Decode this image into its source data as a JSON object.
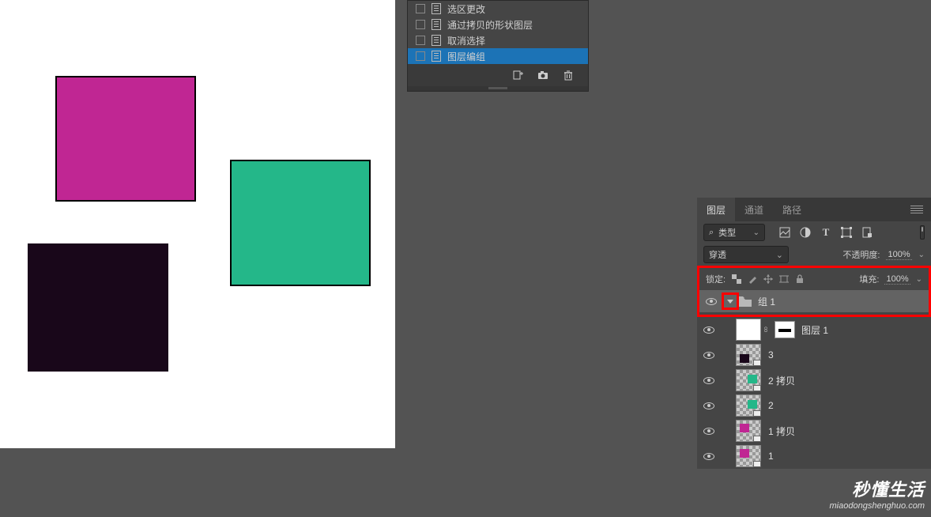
{
  "history": {
    "items": [
      {
        "label": "选区更改"
      },
      {
        "label": "通过拷贝的形状图层"
      },
      {
        "label": "取消选择"
      },
      {
        "label": "图层编组"
      }
    ],
    "selected_index": 3
  },
  "layers_panel": {
    "tabs": {
      "layers": "图层",
      "channels": "通道",
      "paths": "路径"
    },
    "filter": {
      "kind_label": "类型",
      "search_symbol": "⌕"
    },
    "blend": {
      "mode": "穿透",
      "opacity_label": "不透明度:",
      "opacity_value": "100%"
    },
    "lock": {
      "label": "锁定:",
      "fill_label": "填充:",
      "fill_value": "100%"
    },
    "layers": [
      {
        "type": "group",
        "name": "组 1"
      },
      {
        "type": "masked",
        "name": "图层 1"
      },
      {
        "type": "shape",
        "name": "3",
        "thumb_color": "#19071a",
        "rect_style": "left:4px;top:12px;width:12px;height:11px"
      },
      {
        "type": "shape",
        "name": "2 拷贝",
        "thumb_color": "#24b789",
        "rect_style": "left:14px;top:6px;width:12px;height:11px"
      },
      {
        "type": "shape",
        "name": "2",
        "thumb_color": "#24b789",
        "rect_style": "left:14px;top:6px;width:12px;height:11px"
      },
      {
        "type": "shape",
        "name": "1 拷贝",
        "thumb_color": "#c02693",
        "rect_style": "left:4px;top:4px;width:12px;height:11px"
      },
      {
        "type": "shape",
        "name": "1",
        "thumb_color": "#c02693",
        "rect_style": "left:4px;top:4px;width:12px;height:11px"
      }
    ]
  },
  "watermark": {
    "cn": "秒懂生活",
    "en": "miaodongshenghuo.com"
  }
}
